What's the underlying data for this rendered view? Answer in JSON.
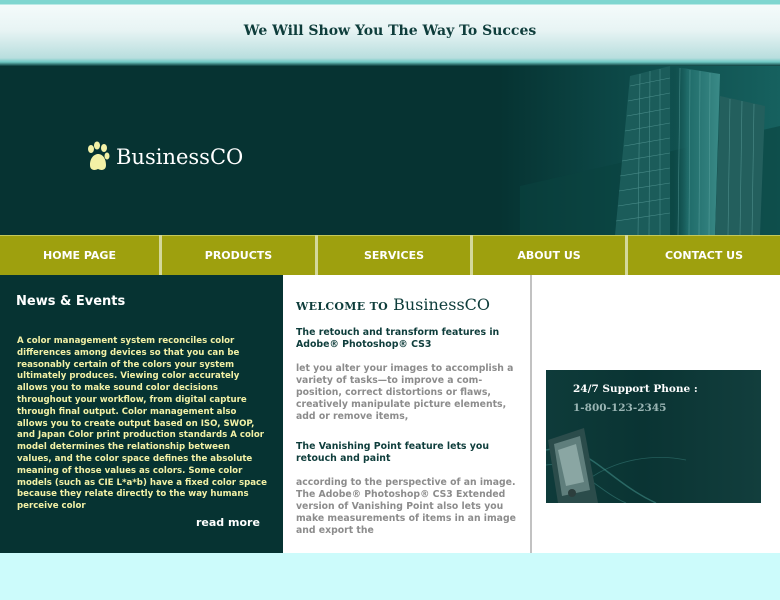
{
  "header": {
    "tagline": "We Will Show You The Way To Succes"
  },
  "brand": {
    "name": "BusinessCO",
    "logo_icon": "paw-print-icon"
  },
  "nav": {
    "items": [
      {
        "label": "HOME PAGE"
      },
      {
        "label": "PRODUCTS"
      },
      {
        "label": "SERVICES"
      },
      {
        "label": "ABOUT US"
      },
      {
        "label": "CONTACT US"
      }
    ]
  },
  "news": {
    "title": "News & Events",
    "body": "A color management system reconciles color differences among devices so that you can be reasonably certain of the colors your system ultimately produces. Viewing color accurately allows you to make sound color decisions throughout your workflow, from digital capture through final output. Color management also allows you to create output based on ISO, SWOP, and Japan Color print production standards A color model determines the relationship between values, and the color space defines the absolute meaning of those values as colors. Some color models (such as CIE L*a*b) have a fixed color space because they relate directly to the way humans perceive color",
    "read_more": "read more"
  },
  "welcome": {
    "prefix": "WELCOME TO",
    "brand": "BusinessCO",
    "heading1": "The retouch and transform features in Adobe® Photoshop® CS3",
    "body1": "let you alter your images to accomplish a variety of tasks—to improve a com-position, correct distortions or flaws, creatively manipulate picture elements, add or remove items,",
    "heading2": "The Vanishing Point feature lets you retouch and paint",
    "body2": "according to the perspective of an image. The Adobe® Photoshop® CS3 Extended version of Vanishing Point also lets you make measurements of items in an image and export the"
  },
  "support": {
    "label": "24/7 Support Phone :",
    "phone": "1-800-123-2345"
  },
  "colors": {
    "dark_teal": "#063332",
    "nav_olive": "#9ea00e",
    "news_text": "#f3f1a6",
    "page_bg": "#ccfbfb"
  }
}
